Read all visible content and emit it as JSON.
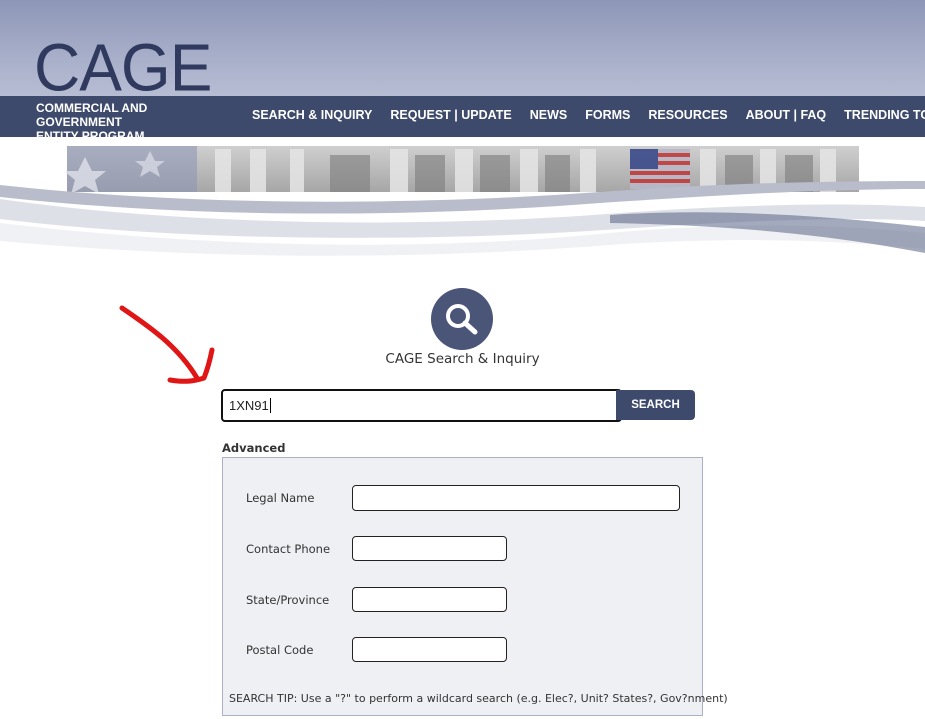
{
  "header": {
    "logo": "CAGE",
    "subtitle_line1": "COMMERCIAL AND GOVERNMENT",
    "subtitle_line2": "ENTITY PROGRAM"
  },
  "nav": [
    "SEARCH & INQUIRY",
    "REQUEST | UPDATE",
    "NEWS",
    "FORMS",
    "RESOURCES",
    "ABOUT | FAQ",
    "TRENDING TOPICS"
  ],
  "search": {
    "title": "CAGE Search & Inquiry",
    "value": "1XN91",
    "button_label": "SEARCH"
  },
  "advanced": {
    "label": "Advanced",
    "fields": [
      {
        "label": "Legal Name",
        "value": ""
      },
      {
        "label": "Contact Phone",
        "value": ""
      },
      {
        "label": "State/Province",
        "value": ""
      },
      {
        "label": "Postal Code",
        "value": ""
      }
    ],
    "tip": "SEARCH TIP: Use a \"?\" to perform a wildcard search (e.g. Elec?, Unit? States?, Gov?nment)"
  },
  "colors": {
    "navbar": "#3d4a6c",
    "header_gradient": "#a6adc8",
    "accent": "#4a5578",
    "annotation_arrow": "#e01515"
  }
}
